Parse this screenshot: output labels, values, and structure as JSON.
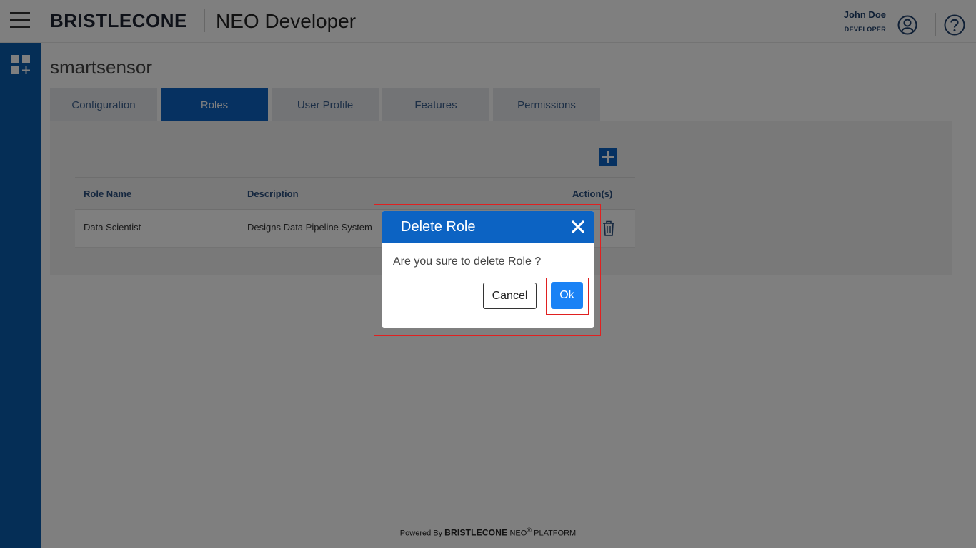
{
  "header": {
    "brand": "BRISTLECONE",
    "app_title": "NEO Developer",
    "user_name": "John Doe",
    "user_role": "DEVELOPER"
  },
  "project": {
    "title": "smartsensor"
  },
  "tabs": [
    {
      "label": "Configuration",
      "active": false
    },
    {
      "label": "Roles",
      "active": true
    },
    {
      "label": "User Profile",
      "active": false
    },
    {
      "label": "Features",
      "active": false
    },
    {
      "label": "Permissions",
      "active": false
    }
  ],
  "table": {
    "headers": {
      "role_name": "Role Name",
      "description": "Description",
      "actions": "Action(s)"
    },
    "rows": [
      {
        "role_name": "Data Scientist",
        "description": "Designs Data Pipeline System"
      }
    ]
  },
  "footer": {
    "powered_by": "Powered By",
    "brand": "BRISTLECONE",
    "neo": "NEO",
    "registered": "®",
    "platform": "PLATFORM"
  },
  "modal": {
    "title": "Delete Role",
    "message": "Are you sure to delete Role ?",
    "cancel_label": "Cancel",
    "ok_label": "Ok"
  },
  "icons": {
    "menu": "hamburger-menu-icon",
    "avatar": "user-circle-icon",
    "help": "question-circle-icon",
    "apps": "apps-add-icon",
    "add": "plus-icon",
    "delete": "trash-icon",
    "close": "close-icon"
  },
  "colors": {
    "primary": "#0c63c3",
    "sidebar": "#0b5cad",
    "ok_button": "#1a82f5",
    "highlight": "#e02020"
  }
}
